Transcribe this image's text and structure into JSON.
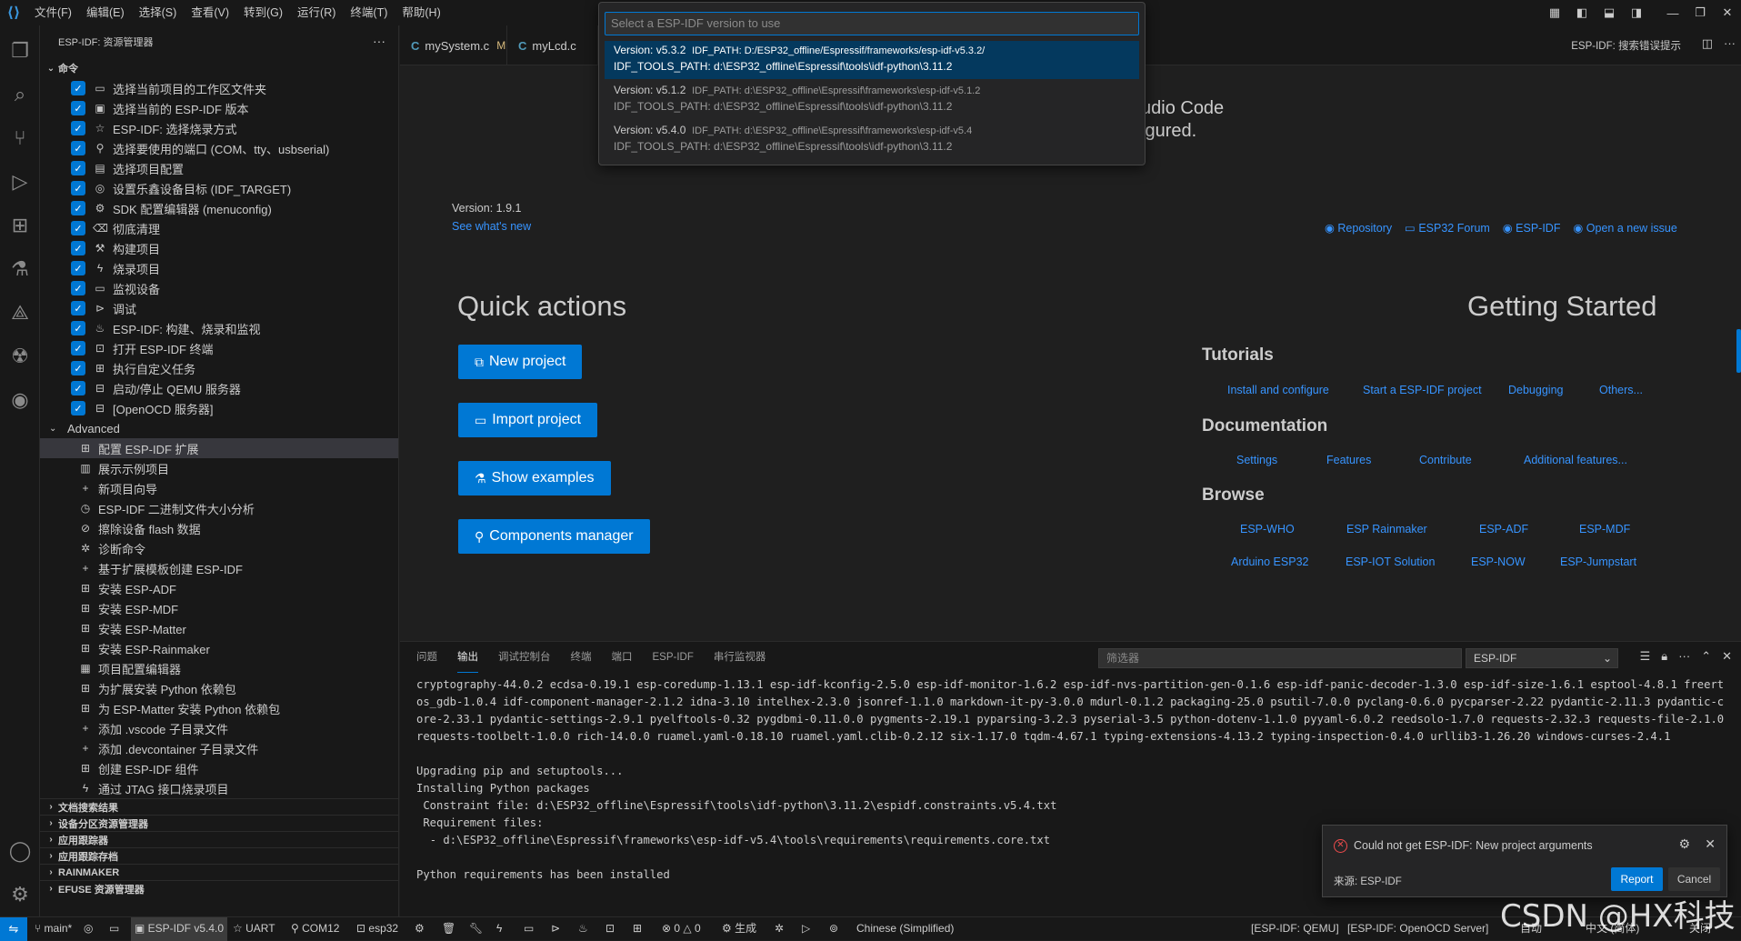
{
  "titlebar": {
    "menus": [
      "文件(F)",
      "编辑(E)",
      "选择(S)",
      "查看(V)",
      "转到(G)",
      "运行(R)",
      "终端(T)",
      "帮助(H)"
    ]
  },
  "sidebar": {
    "title": "ESP-IDF: 资源管理器",
    "commands_section": "命令",
    "commands": [
      {
        "label": "选择当前项目的工作区文件夹",
        "icon": "folder-icon"
      },
      {
        "label": "选择当前的 ESP-IDF 版本",
        "icon": "chip-icon"
      },
      {
        "label": "ESP-IDF: 选择烧录方式",
        "icon": "star-icon"
      },
      {
        "label": "选择要使用的端口 (COM、tty、usbserial)",
        "icon": "plug-icon"
      },
      {
        "label": "选择项目配置",
        "icon": "config-icon"
      },
      {
        "label": "设置乐鑫设备目标 (IDF_TARGET)",
        "icon": "target-icon"
      },
      {
        "label": "SDK 配置编辑器 (menuconfig)",
        "icon": "gear-icon"
      },
      {
        "label": "彻底清理",
        "icon": "trash-icon"
      },
      {
        "label": "构建项目",
        "icon": "wrench-icon"
      },
      {
        "label": "烧录项目",
        "icon": "flash-icon"
      },
      {
        "label": "监视设备",
        "icon": "monitor-icon"
      },
      {
        "label": "调试",
        "icon": "debug-icon"
      },
      {
        "label": "ESP-IDF: 构建、烧录和监视",
        "icon": "flame-icon"
      },
      {
        "label": "打开 ESP-IDF 终端",
        "icon": "terminal-icon"
      },
      {
        "label": "执行自定义任务",
        "icon": "task-icon"
      },
      {
        "label": "启动/停止 QEMU 服务器",
        "icon": "server-icon"
      },
      {
        "label": "[OpenOCD 服务器]",
        "icon": "server-icon"
      }
    ],
    "advanced_label": "Advanced",
    "advanced": [
      {
        "label": "配置 ESP-IDF 扩展",
        "icon": "extensions-icon"
      },
      {
        "label": "展示示例项目",
        "icon": "book-icon"
      },
      {
        "label": "新项目向导",
        "icon": "plus-icon"
      },
      {
        "label": "ESP-IDF 二进制文件大小分析",
        "icon": "size-icon"
      },
      {
        "label": "擦除设备 flash 数据",
        "icon": "erase-icon"
      },
      {
        "label": "诊断命令",
        "icon": "bug-icon"
      },
      {
        "label": "基于扩展模板创建 ESP-IDF",
        "icon": "plus-icon"
      },
      {
        "label": "安装 ESP-ADF",
        "icon": "extensions-icon"
      },
      {
        "label": "安装 ESP-MDF",
        "icon": "extensions-icon"
      },
      {
        "label": "安装 ESP-Matter",
        "icon": "extensions-icon"
      },
      {
        "label": "安装 ESP-Rainmaker",
        "icon": "extensions-icon"
      },
      {
        "label": "项目配置编辑器",
        "icon": "editor-icon"
      },
      {
        "label": "为扩展安装 Python 依赖包",
        "icon": "extensions-icon"
      },
      {
        "label": "为 ESP-Matter 安装 Python 依赖包",
        "icon": "extensions-icon"
      },
      {
        "label": "添加 .vscode 子目录文件",
        "icon": "plus-icon"
      },
      {
        "label": "添加 .devcontainer 子目录文件",
        "icon": "plus-icon"
      },
      {
        "label": "创建 ESP-IDF 组件",
        "icon": "extensions-icon"
      },
      {
        "label": "通过 JTAG 接口烧录项目",
        "icon": "flash-icon"
      }
    ],
    "bottom_sections": [
      "文档搜索结果",
      "设备分区资源管理器",
      "应用跟踪器",
      "应用跟踪存档",
      "RAINMAKER",
      "EFUSE 资源管理器"
    ]
  },
  "tabs": [
    {
      "label": "mySystem.c",
      "modified": "M"
    },
    {
      "label": "myLcd.c",
      "modified": ""
    }
  ],
  "tabs_right_title": "ESP-IDF: 搜索错误提示",
  "quickpick": {
    "placeholder": "Select a ESP-IDF version to use",
    "items": [
      {
        "version": "Version: v5.3.2",
        "idf_path": "IDF_PATH: D:/ESP32_offline/Espressif/frameworks/esp-idf-v5.3.2/",
        "tools_path": "IDF_TOOLS_PATH: d:\\ESP32_offline\\Espressif\\tools\\idf-python\\3.11.2"
      },
      {
        "version": "Version: v5.1.2",
        "idf_path": "IDF_PATH: d:\\ESP32_offline\\Espressif\\frameworks\\esp-idf-v5.1.2",
        "tools_path": "IDF_TOOLS_PATH: d:\\ESP32_offline\\Espressif\\tools\\idf-python\\3.11.2"
      },
      {
        "version": "Version: v5.4.0",
        "idf_path": "IDF_PATH: d:\\ESP32_offline\\Espressif\\frameworks\\esp-idf-v5.4",
        "tools_path": "IDF_TOOLS_PATH: d:\\ESP32_offline\\Espressif\\tools\\idf-python\\3.11.2"
      }
    ]
  },
  "welcome": {
    "behind_text_1": "udio Code",
    "behind_text_2": "igured.",
    "colon": ":",
    "version": "Version: 1.9.1",
    "whats_new": "See what's new",
    "top_links": [
      "Repository",
      "ESP32 Forum",
      "ESP-IDF",
      "Open a new issue"
    ],
    "quick_actions_title": "Quick actions",
    "buttons": [
      "New project",
      "Import project",
      "Show examples",
      "Components manager"
    ],
    "getting_started_title": "Getting Started",
    "tutorials_title": "Tutorials",
    "tutorials": [
      "Install and configure",
      "Start a ESP-IDF project",
      "Debugging",
      "Others..."
    ],
    "documentation_title": "Documentation",
    "documentation": [
      "Settings",
      "Features",
      "Contribute",
      "Additional features..."
    ],
    "browse_title": "Browse",
    "browse_row1": [
      "ESP-WHO",
      "ESP Rainmaker",
      "ESP-ADF",
      "ESP-MDF"
    ],
    "browse_row2": [
      "Arduino ESP32",
      "ESP-IOT Solution",
      "ESP-NOW",
      "ESP-Jumpstart"
    ]
  },
  "panel": {
    "tabs": [
      "问题",
      "输出",
      "调试控制台",
      "终端",
      "端口",
      "ESP-IDF",
      "串行监视器"
    ],
    "active_tab": "输出",
    "filter_placeholder": "筛选器",
    "channel": "ESP-IDF",
    "output": "cryptography-44.0.2 ecdsa-0.19.1 esp-coredump-1.13.1 esp-idf-kconfig-2.5.0 esp-idf-monitor-1.6.2 esp-idf-nvs-partition-gen-0.1.6 esp-idf-panic-decoder-1.3.0 esp-idf-size-1.6.1 esptool-4.8.1 freertos_gdb-1.0.4 idf-component-manager-2.1.2 idna-3.10 intelhex-2.3.0 jsonref-1.1.0 markdown-it-py-3.0.0 mdurl-0.1.2 packaging-25.0 psutil-7.0.0 pyclang-0.6.0 pycparser-2.22 pydantic-2.11.3 pydantic-core-2.33.1 pydantic-settings-2.9.1 pyelftools-0.32 pygdbmi-0.11.0.0 pygments-2.19.1 pyparsing-3.2.3 pyserial-3.5 python-dotenv-1.1.0 pyyaml-6.0.2 reedsolo-1.7.0 requests-2.32.3 requests-file-2.1.0 requests-toolbelt-1.0.0 rich-14.0.0 ruamel.yaml-0.18.10 ruamel.yaml.clib-0.2.12 six-1.17.0 tqdm-4.67.1 typing-extensions-4.13.2 typing-inspection-0.4.0 urllib3-1.26.20 windows-curses-2.4.1\n\nUpgrading pip and setuptools...\nInstalling Python packages\n Constraint file: d:\\ESP32_offline\\Espressif\\tools\\idf-python\\3.11.2\\espidf.constraints.v5.4.txt\n Requirement files:\n  - d:\\ESP32_offline\\Espressif\\frameworks\\esp-idf-v5.4\\tools\\requirements\\requirements.core.txt\n\nPython requirements has been installed"
  },
  "notification": {
    "message": "Could not get ESP-IDF: New project arguments",
    "source": "来源: ESP-IDF",
    "report": "Report",
    "cancel": "Cancel"
  },
  "statusbar": {
    "branch": "main*",
    "idf_version": "ESP-IDF v5.4.0",
    "flash_mode": "UART",
    "port": "COM12",
    "target": "esp32",
    "problems": "0",
    "warnings": "0",
    "build_label": "生成",
    "language": "Chinese (Simplified)",
    "qemu": "[ESP-IDF: QEMU]",
    "openocd": "[ESP-IDF: OpenOCD Server]",
    "auto": "自动",
    "lang2": "中文 (简体)",
    "close": "关闭"
  },
  "watermark": "CSDN @HX科技",
  "colors": {
    "accent": "#0078d4",
    "link": "#3794ff",
    "error": "#f14c4c"
  }
}
